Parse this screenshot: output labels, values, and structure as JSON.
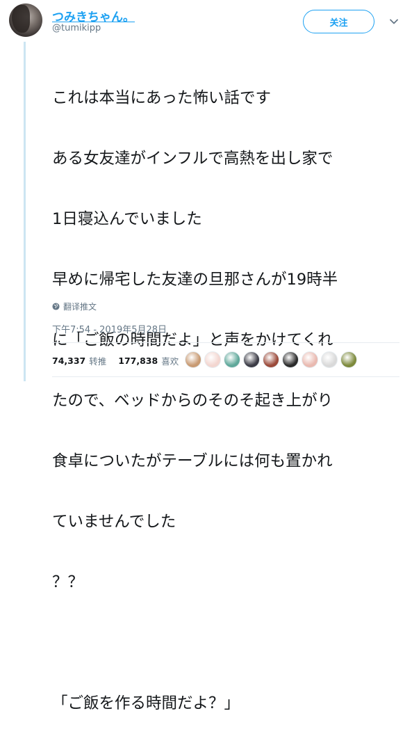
{
  "author": {
    "display_name": "つみきちゃん。",
    "username": "@tumikipp"
  },
  "follow_button": {
    "label": "关注"
  },
  "tweet": {
    "lines": [
      "これは本当にあった怖い話です",
      "ある女友達がインフルで高熱を出し家で",
      "1日寝込んでいました",
      "早めに帰宅した友達の旦那さんが19時半",
      "に「ご飯の時間だよ」と声をかけてくれ",
      "たので、ベッドからのそのそ起き上がり",
      "食卓についたがテーブルには何も置かれ",
      "ていませんでした",
      "？？",
      "",
      "「ご飯を作る時間だよ？」"
    ],
    "translate_label": "翻译推文",
    "timestamp": "下午7:54 - 2019年5月28日"
  },
  "stats": {
    "retweets": "74,337",
    "retweets_label": "转推",
    "likes": "177,838",
    "likes_label": "喜欢"
  },
  "liker_avatars": [
    {
      "name": "liker-avatar-1",
      "color": "#c89a72"
    },
    {
      "name": "liker-avatar-2",
      "color": "#f3d6d0"
    },
    {
      "name": "liker-avatar-3",
      "color": "#5fa89a"
    },
    {
      "name": "liker-avatar-4",
      "color": "#3c3c46"
    },
    {
      "name": "liker-avatar-5",
      "color": "#9b4a3a"
    },
    {
      "name": "liker-avatar-6",
      "color": "#2b2b2b"
    },
    {
      "name": "liker-avatar-7",
      "color": "#e9b9b0"
    },
    {
      "name": "liker-avatar-8",
      "color": "#d9d9d9"
    },
    {
      "name": "liker-avatar-9",
      "color": "#7d8a3c"
    }
  ],
  "colors": {
    "accent": "#1da1f2",
    "secondary_text": "#657786",
    "thread_line": "#cce5f2"
  }
}
